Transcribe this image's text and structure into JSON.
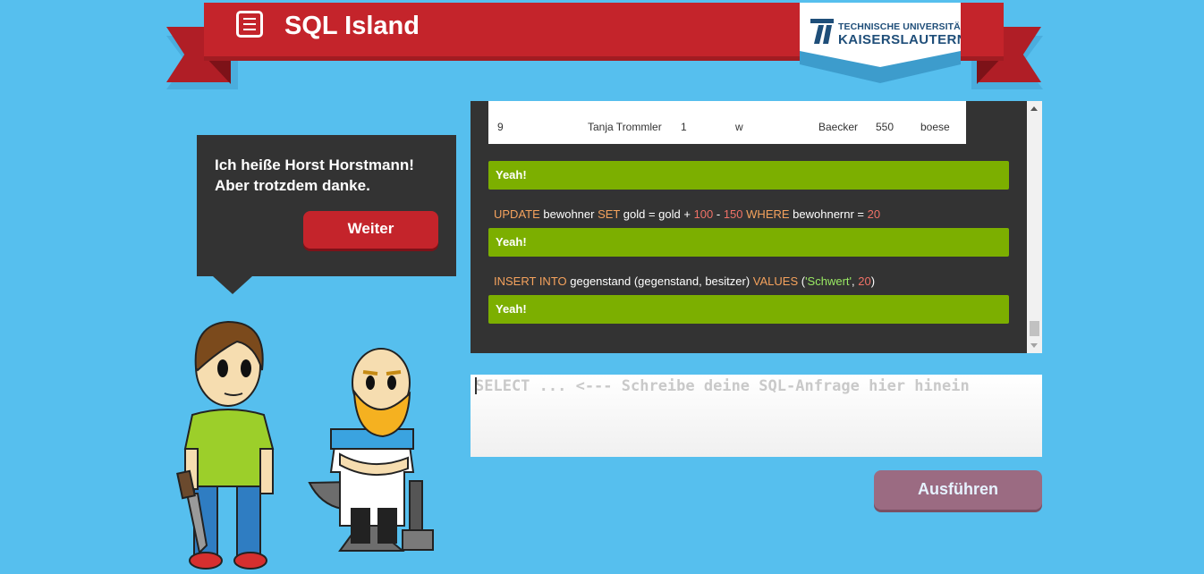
{
  "header": {
    "title": "SQL Island",
    "university_line1": "TECHNISCHE UNIVERSITÄT",
    "university_line2": "KAISERSLAUTERN"
  },
  "dialog": {
    "line1": "Ich heiße Horst Horstmann!",
    "line2": "Aber trotzdem danke.",
    "next_button": "Weiter"
  },
  "log": {
    "table_row": [
      "9",
      "Tanja Trommler",
      "1",
      "w",
      "Baecker",
      "550",
      "boese"
    ],
    "ok_label": "Yeah!",
    "query1": {
      "kw1": "UPDATE",
      "t1": " bewohner ",
      "kw2": "SET",
      "t2": " gold = gold + ",
      "n1": "100",
      "t3": " - ",
      "n2": "150",
      "t4": " ",
      "kw3": "WHERE",
      "t5": " bewohnernr = ",
      "n3": "20"
    },
    "query2": {
      "kw1": "INSERT INTO",
      "t1": " gegenstand (gegenstand, besitzer) ",
      "kw2": "VALUES",
      "t2": " (",
      "s1": "'Schwert'",
      "t3": ", ",
      "n1": "20",
      "t4": ")"
    }
  },
  "query_input": {
    "placeholder": "SELECT ... <--- Schreibe deine SQL-Anfrage hier hinein",
    "value": ""
  },
  "run_button": "Ausführen",
  "colors": {
    "background": "#56bfee",
    "ribbon": "#c4242b",
    "panel": "#333333",
    "success": "#7caf00",
    "run_button": "#9b6b82"
  }
}
